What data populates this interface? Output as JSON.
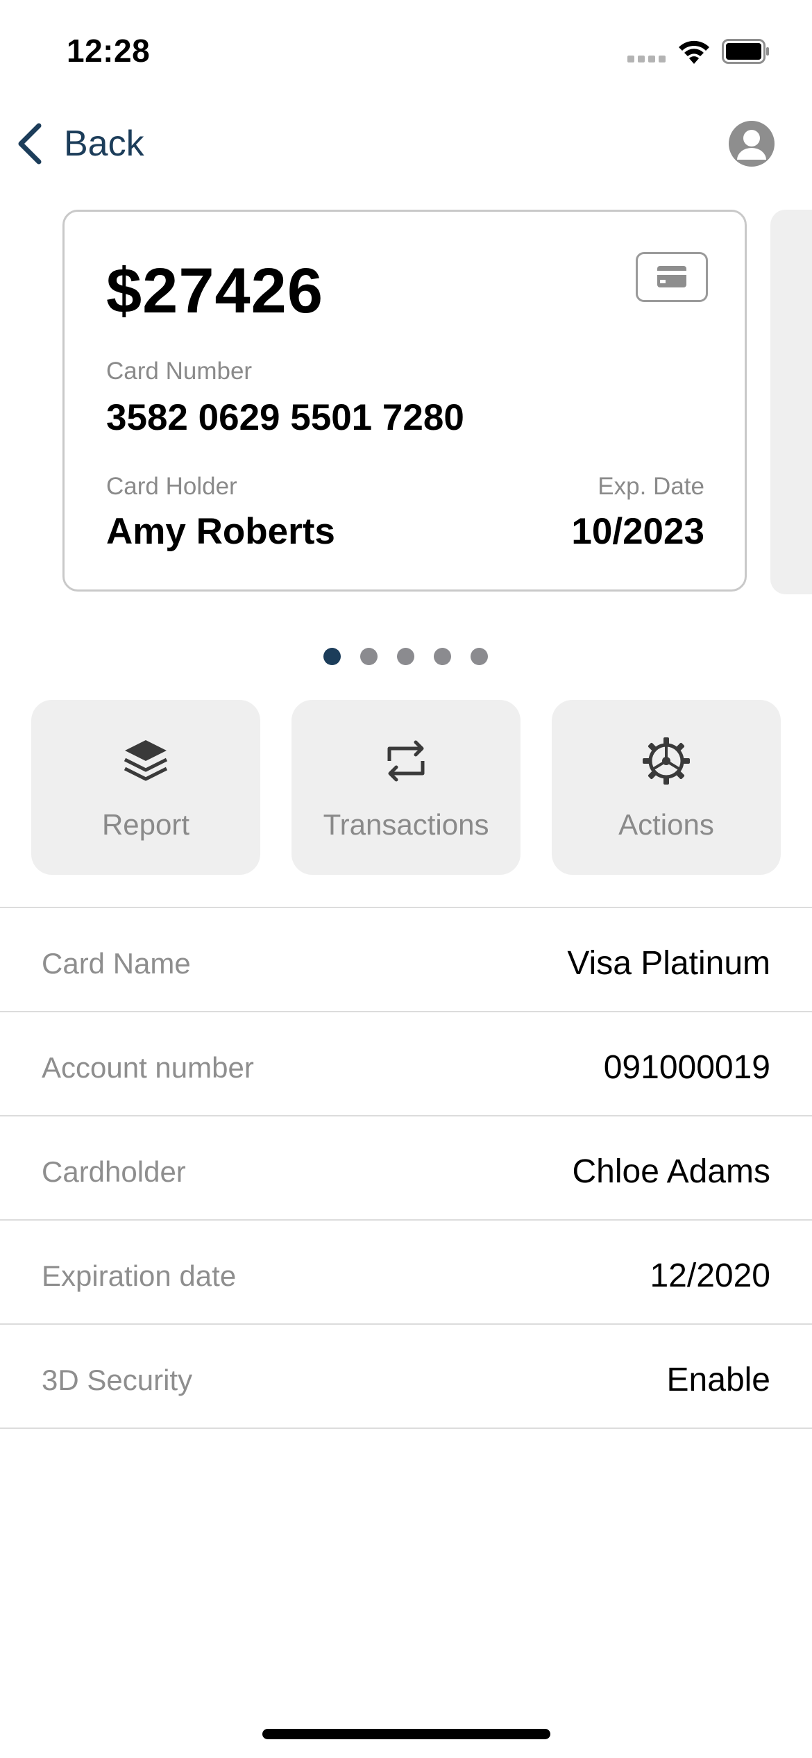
{
  "status_bar": {
    "time": "12:28"
  },
  "nav": {
    "back_label": "Back",
    "accent_color": "#1c3d5a"
  },
  "card": {
    "balance": "$27426",
    "number_label": "Card Number",
    "number": "3582 0629 5501 7280",
    "holder_label": "Card Holder",
    "holder": "Amy Roberts",
    "exp_label": "Exp. Date",
    "exp": "10/2023",
    "type_icon": "credit-card-icon"
  },
  "pager": {
    "count": 5,
    "active_index": 0
  },
  "actions": [
    {
      "label": "Report",
      "icon": "layers-icon"
    },
    {
      "label": "Transactions",
      "icon": "repeat-icon"
    },
    {
      "label": "Actions",
      "icon": "gear-icon"
    }
  ],
  "details": [
    {
      "label": "Card Name",
      "value": "Visa Platinum"
    },
    {
      "label": "Account number",
      "value": "091000019"
    },
    {
      "label": "Cardholder",
      "value": "Chloe Adams"
    },
    {
      "label": "Expiration date",
      "value": "12/2020"
    },
    {
      "label": "3D Security",
      "value": "Enable"
    }
  ]
}
